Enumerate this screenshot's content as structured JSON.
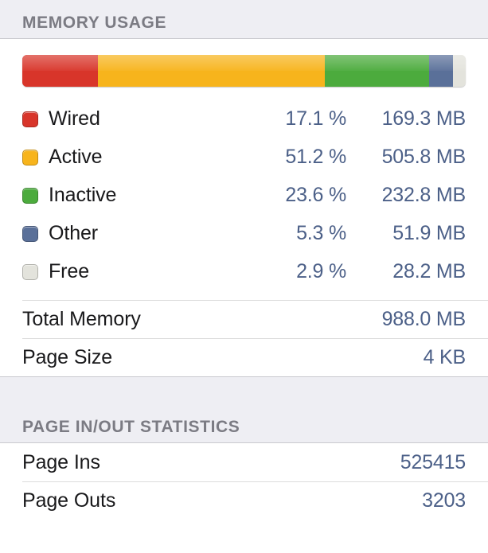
{
  "sections": [
    {
      "title": "MEMORY USAGE",
      "bar": {
        "name": "memory-usage-bar",
        "segments": [
          {
            "name": "Wired",
            "percent": 17.1,
            "color": "#d8352a"
          },
          {
            "name": "Active",
            "percent": 51.2,
            "color": "#f7b41c"
          },
          {
            "name": "Inactive",
            "percent": 23.6,
            "color": "#4cab3d"
          },
          {
            "name": "Other",
            "percent": 5.3,
            "color": "#5a7099"
          },
          {
            "name": "Free",
            "percent": 2.9,
            "color": "#e3e3dc"
          }
        ]
      },
      "legend_rows": [
        {
          "label": "Wired",
          "percent": "17.1 %",
          "size": "169.3 MB",
          "color": "#d8352a"
        },
        {
          "label": "Active",
          "percent": "51.2 %",
          "size": "505.8 MB",
          "color": "#f7b41c"
        },
        {
          "label": "Inactive",
          "percent": "23.6 %",
          "size": "232.8 MB",
          "color": "#4cab3d"
        },
        {
          "label": "Other",
          "percent": "5.3 %",
          "size": "51.9 MB",
          "color": "#5a7099"
        },
        {
          "label": "Free",
          "percent": "2.9 %",
          "size": "28.2 MB",
          "color": "#e3e3dc"
        }
      ],
      "summary_rows": [
        {
          "label": "Total Memory",
          "value": "988.0 MB"
        },
        {
          "label": "Page Size",
          "value": "4 KB"
        }
      ]
    },
    {
      "title": "PAGE IN/OUT STATISTICS",
      "stat_rows": [
        {
          "label": "Page Ins",
          "value": "525415"
        },
        {
          "label": "Page Outs",
          "value": "3203"
        }
      ]
    }
  ],
  "chart_data": {
    "type": "bar",
    "title": "MEMORY USAGE",
    "categories": [
      "Wired",
      "Active",
      "Inactive",
      "Other",
      "Free"
    ],
    "values": [
      17.1,
      51.2,
      23.6,
      5.3,
      2.9
    ],
    "value_unit": "%",
    "secondary_values": [
      169.3,
      505.8,
      232.8,
      51.9,
      28.2
    ],
    "secondary_unit": "MB",
    "total": 988.0,
    "total_unit": "MB",
    "colors": [
      "#d8352a",
      "#f7b41c",
      "#4cab3d",
      "#5a7099",
      "#e3e3dc"
    ],
    "xlabel": "",
    "ylabel": "",
    "ylim": [
      0,
      100
    ],
    "grid": false,
    "legend": "below"
  }
}
